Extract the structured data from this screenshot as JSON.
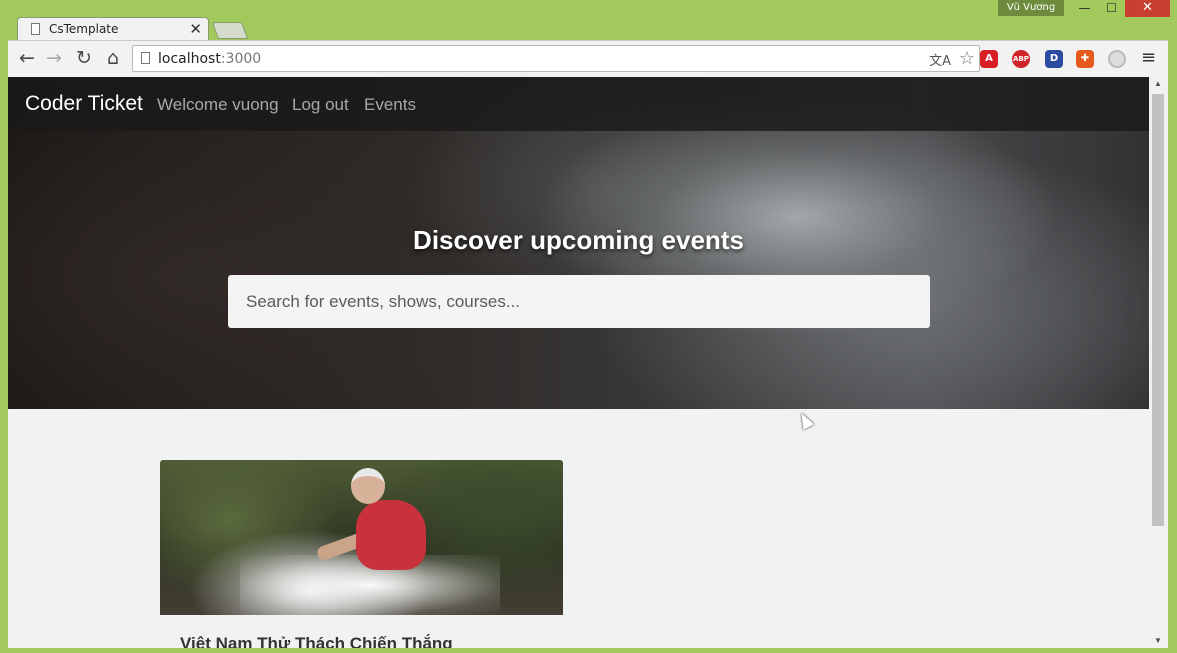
{
  "window": {
    "user_label": "Vũ Vương",
    "minimize_glyph": "—",
    "maximize_glyph": "☐",
    "close_glyph": "✕"
  },
  "browser": {
    "tab_title": "CsTemplate",
    "tab_close_glyph": "✕",
    "url_host": "localhost",
    "url_port": ":3000",
    "icons": {
      "back": "arrow-left-icon",
      "forward": "arrow-right-icon",
      "reload": "reload-icon",
      "home": "home-icon",
      "bookmark": "star-icon",
      "menu": "hamburger-menu-icon"
    },
    "back_glyph": "←",
    "forward_glyph": "→",
    "reload_glyph": "↻",
    "home_glyph": "⌂",
    "translate_glyph": "文A",
    "star_glyph": "☆",
    "menu_glyph": "≡",
    "extensions": [
      {
        "name": "avira-extension-icon",
        "glyph": "A",
        "color": "#d91f26"
      },
      {
        "name": "adblock-plus-icon",
        "glyph": "ABP",
        "color": "#d0232a"
      },
      {
        "name": "d-extension-icon",
        "glyph": "D",
        "color": "#2b4b9e"
      },
      {
        "name": "puzzle-extension-icon",
        "glyph": "✚",
        "color": "#e65a1c"
      },
      {
        "name": "circle-extension-icon",
        "glyph": "",
        "color": "#dddddd"
      }
    ]
  },
  "site": {
    "navbar": {
      "brand": "Coder Ticket",
      "welcome": "Welcome vuong",
      "logout": "Log out",
      "events": "Events"
    },
    "hero": {
      "title": "Discover upcoming events",
      "search_placeholder": "Search for events, shows, courses..."
    },
    "events": [
      {
        "title": "Việt Nam Thử Thách Chiến Thắng"
      }
    ]
  },
  "scrollbar": {
    "up_glyph": "▲",
    "down_glyph": "▼"
  }
}
